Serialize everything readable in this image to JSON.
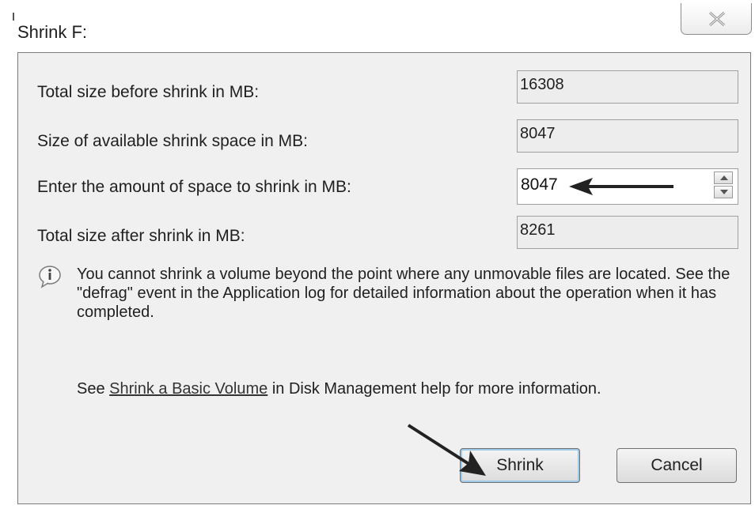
{
  "dialog": {
    "title": "Shrink F:",
    "close_icon": "close-x-icon"
  },
  "fields": {
    "total_before": {
      "label": "Total size before shrink in MB:",
      "value": "16308"
    },
    "available": {
      "label": "Size of available shrink space in MB:",
      "value": "8047"
    },
    "amount": {
      "label": "Enter the amount of space to shrink in MB:",
      "value": "8047"
    },
    "total_after": {
      "label": "Total size after shrink in MB:",
      "value": "8261"
    }
  },
  "info": {
    "icon": "info-icon",
    "text": "You cannot shrink a volume beyond the point where any unmovable files are located. See the \"defrag\" event in the Application log for detailed information about the operation when it has completed."
  },
  "help": {
    "prefix": "See ",
    "link": "Shrink a Basic Volume",
    "suffix": " in Disk Management help for more information."
  },
  "buttons": {
    "shrink": "Shrink",
    "cancel": "Cancel"
  },
  "colors": {
    "panel_bg": "#f0f0f0",
    "focus_ring": "#9ec9e8"
  }
}
